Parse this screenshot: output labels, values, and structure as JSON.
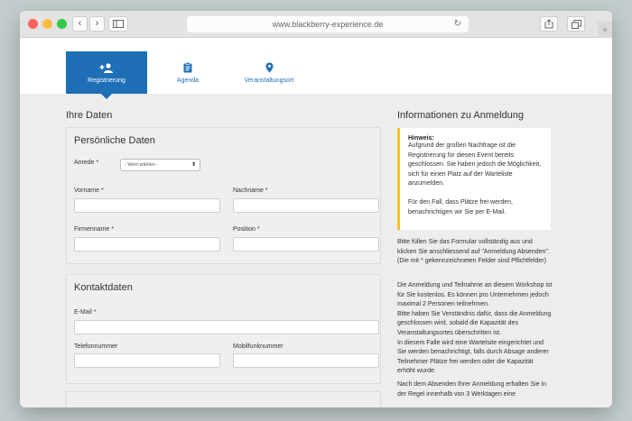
{
  "browser": {
    "url": "www.blackberry-experience.de",
    "back": "‹",
    "forward": "›",
    "reload": "↻",
    "plus": "+"
  },
  "nav": {
    "tabs": [
      {
        "label": "Registrierung",
        "icon": "add-person-icon"
      },
      {
        "label": "Agenda",
        "icon": "clipboard-icon"
      },
      {
        "label": "Veranstaltungsort",
        "icon": "map-pin-icon"
      }
    ],
    "active_color": "#1e6fb5"
  },
  "main": {
    "title": "Ihre Daten",
    "personal": {
      "title": "Persönliche Daten",
      "salutation_label": "Anrede *",
      "salutation_value": "- Wert wählen -",
      "firstname_label": "Vorname *",
      "lastname_label": "Nachname *",
      "company_label": "Firmenname *",
      "position_label": "Position *"
    },
    "contact": {
      "title": "Kontaktdaten",
      "email_label": "E-Mail *",
      "phone_label": "Telefonnummer",
      "mobile_label": "Mobilfunknummer"
    }
  },
  "sidebar": {
    "title": "Informationen zu Anmeldung",
    "notice_title": "Hinweis:",
    "notice_body": "Aufgrund der großen Nachfrage ist die Registrierung für diesen Event bereits geschlossen. Sie haben jedoch die Möglichkeit, sich für einen Platz auf der Warteliste anzumelden.",
    "notice_body2": "Für den Fall, dass Plätze frei werden, benachrichtigen wir Sie per E-Mail.",
    "notice_color": "#f2c12e",
    "para1": "Bitte füllen Sie das Formular vollständig aus und klicken Sie anschliessend auf \"Anmeldung Absenden\". (Die mit * gekennzeichneten Felder sind Pflichtfelder)",
    "para2_line1": "Die Anmeldung und Teilnahme an diesem Workshop ist für Sie kostenlos. Es können pro Unternehmen jedoch maximal 2 Personen teilnehmen.",
    "para2_line2": "Bitte haben Sie Verständnis dafür, dass die Anmeldung geschlossen wird, sobald die Kapazität des Veranstaltungsortes überschritten ist.",
    "para2_line3": "In diesem Falle wird eine Wartelsite eingerichtet und Sie werden benachrichtigt, falls durch Absage anderer Teilnehmer Plätze frei werden oder die Kapazität erhöht wurde.",
    "para3": "Nach dem Absenden Ihrer Anmeldung erhalten Sie in der Regel innerhalb von 3 Werktagen eine"
  }
}
